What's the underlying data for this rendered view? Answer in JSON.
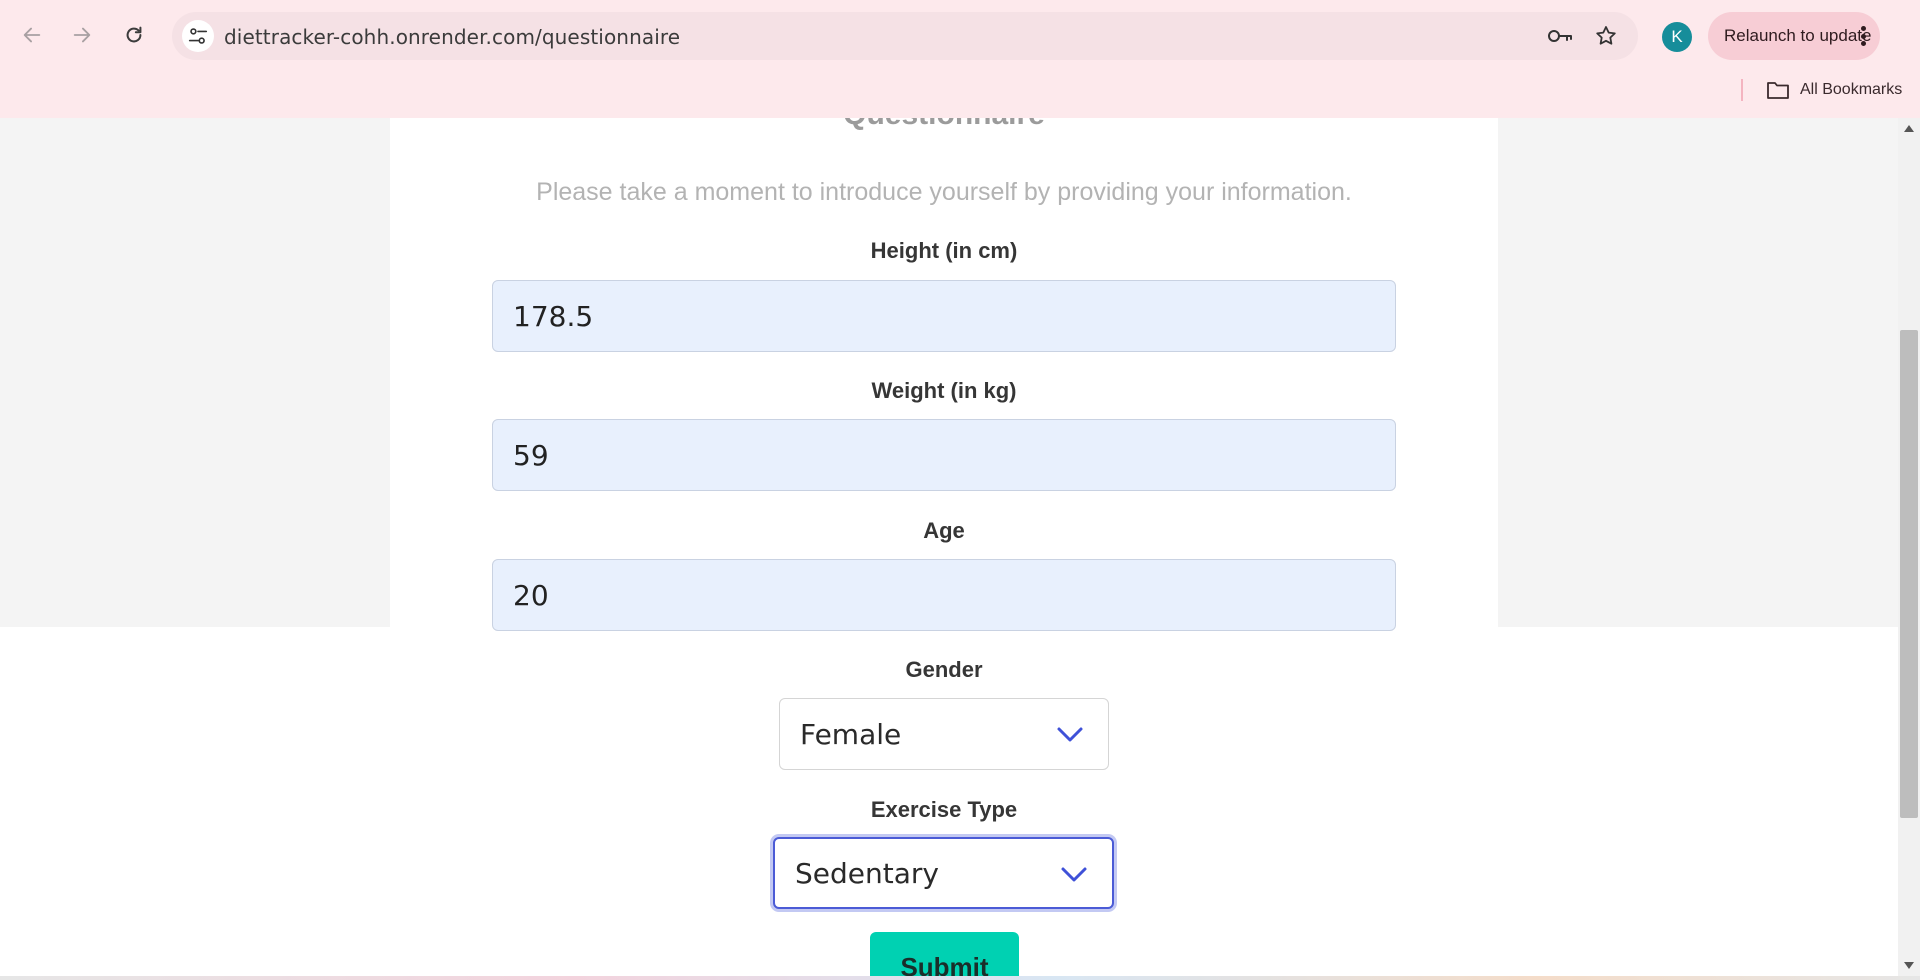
{
  "browser": {
    "url": "diettracker-cohh.onrender.com/questionnaire",
    "profile_initial": "K",
    "relaunch_label": "Relaunch to update",
    "bookmarks_label": "All Bookmarks",
    "icons": {
      "back": "arrow-left-icon",
      "forward": "arrow-right-icon",
      "reload": "reload-icon",
      "site_info": "tune-icon",
      "passwords": "key-icon",
      "bookmark": "star-icon",
      "menu": "more-vert-icon",
      "folder": "folder-icon"
    }
  },
  "page": {
    "title": "Questionnaire",
    "intro": "Please take a moment to introduce yourself by providing your information.",
    "fields": {
      "height": {
        "label": "Height (in cm)",
        "value": "178.5"
      },
      "weight": {
        "label": "Weight (in kg)",
        "value": "59"
      },
      "age": {
        "label": "Age",
        "value": "20"
      },
      "gender": {
        "label": "Gender",
        "value": "Female"
      },
      "exercise": {
        "label": "Exercise Type",
        "value": "Sedentary"
      }
    },
    "submit_label": "Submit"
  },
  "colors": {
    "chrome_bg": "#fde9ec",
    "input_bg": "#e8f0fd",
    "accent_button": "#00d1b2",
    "focus_ring": "#4b5bd6",
    "chevron": "#3f51d8",
    "avatar": "#168d9a"
  }
}
